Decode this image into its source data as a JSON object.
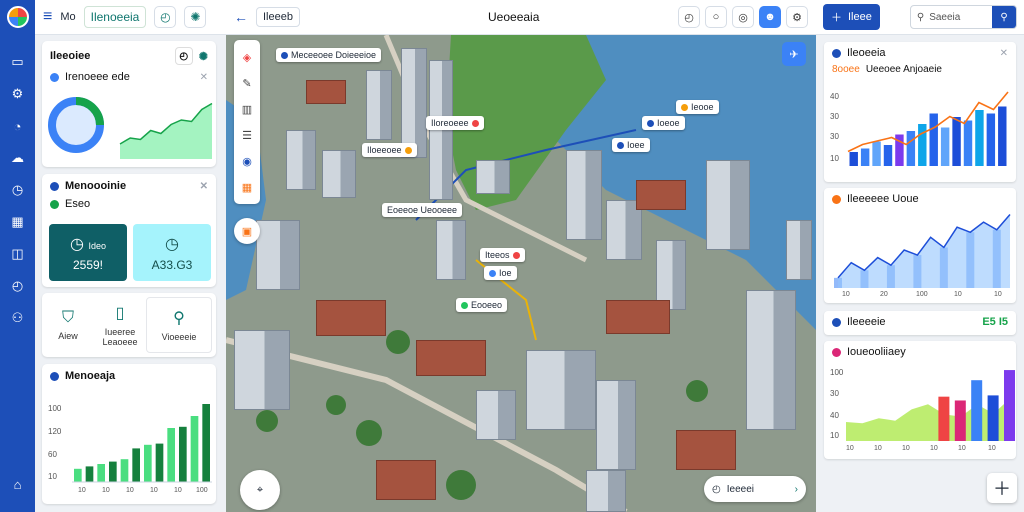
{
  "rail": {
    "icons": [
      "app-logo",
      "panel-icon",
      "settings-icon",
      "chart-pie-icon",
      "cloud-icon",
      "gauge-icon",
      "calendar-icon",
      "layers-icon",
      "clock-icon",
      "user-icon",
      "home-icon"
    ]
  },
  "left": {
    "header_label": "Mo",
    "tab_label": "Ilenoeeia",
    "card1": {
      "title": "Ileeoiee",
      "sub_title": "Irenoeee ede"
    },
    "card2": {
      "title": "Menoooinie",
      "sub_title": "Eseo",
      "tile1": {
        "label": "Ideo",
        "value": "2559!"
      },
      "tile2": {
        "label": "",
        "value": "A33.G3"
      }
    },
    "card3": {
      "items": [
        "Aiew",
        "Iueeree Leaoeee",
        "Vioeeeie"
      ]
    },
    "card4": {
      "title": "Menoeaja",
      "y_ticks": [
        "100",
        "120",
        "60",
        "10"
      ],
      "x_ticks": [
        "10",
        "10",
        "10",
        "10",
        "10",
        "100"
      ]
    }
  },
  "map": {
    "crumb": "Ileeeb",
    "title": "Ueoeeaia",
    "pins": [
      {
        "text": "Meceeoee Doieeeioe",
        "color": "#1d4fb8"
      },
      {
        "text": "Iloreoeee",
        "color": "#ef4444"
      },
      {
        "text": "Iloeeoee",
        "color": "#f59e0b"
      },
      {
        "text": "Eoeeoe Ueooeee",
        "color": "#22c55e"
      },
      {
        "text": "Iteeos",
        "color": "#ef4444"
      },
      {
        "text": "Ioe",
        "color": "#3b82f6"
      },
      {
        "text": "Ioeoe",
        "color": "#f59e0b"
      },
      {
        "text": "Ioee",
        "color": "#1d4fb8"
      },
      {
        "text": "Ieooe",
        "color": "#3b82f6"
      },
      {
        "text": "Eooeeo",
        "color": "#22c55e"
      }
    ],
    "search_label": "Ieeeei"
  },
  "right": {
    "new_label": "Ileee",
    "search_placeholder": "Saeeia",
    "card1": {
      "title": "Ileoeeia",
      "subtitle_accent": "8ooee",
      "subtitle": "Ueeoee Anjoaeie",
      "y_ticks": [
        "40",
        "30",
        "30",
        "10"
      ]
    },
    "card2": {
      "title": "Ileeeeee Uoue",
      "x_ticks": [
        "10",
        "20",
        "100",
        "10",
        "10"
      ]
    },
    "card3": {
      "title": "Ileeeeie",
      "value": "E5 I5"
    },
    "card4": {
      "title": "Ioueooliiaey",
      "y_ticks": [
        "100",
        "30",
        "40",
        "10"
      ],
      "x_ticks": [
        "10",
        "10",
        "10",
        "10",
        "10",
        "10"
      ]
    }
  },
  "chart_data": [
    {
      "type": "line",
      "name": "left-sparkline",
      "values": [
        20,
        28,
        26,
        38,
        34,
        46,
        52,
        50,
        66,
        74
      ]
    },
    {
      "type": "bar",
      "name": "left-bars",
      "values": [
        22,
        26,
        30,
        34,
        38,
        56,
        62,
        64,
        90,
        92,
        110,
        130
      ]
    },
    {
      "type": "bar",
      "name": "right-combo-bars",
      "values": [
        8,
        10,
        14,
        12,
        18,
        20,
        24,
        30,
        22,
        28,
        26,
        32,
        30,
        34
      ],
      "line": [
        6,
        10,
        12,
        14,
        10,
        16,
        20,
        26,
        22,
        34,
        30,
        40
      ]
    },
    {
      "type": "area",
      "name": "right-area",
      "values": [
        8,
        20,
        14,
        24,
        18,
        30,
        26,
        40,
        32,
        48,
        44,
        52,
        46,
        58
      ]
    },
    {
      "type": "bar",
      "name": "right-bottom-bars",
      "values": [
        30,
        28,
        36,
        32,
        50,
        58,
        70,
        64,
        96,
        72,
        112
      ]
    }
  ]
}
